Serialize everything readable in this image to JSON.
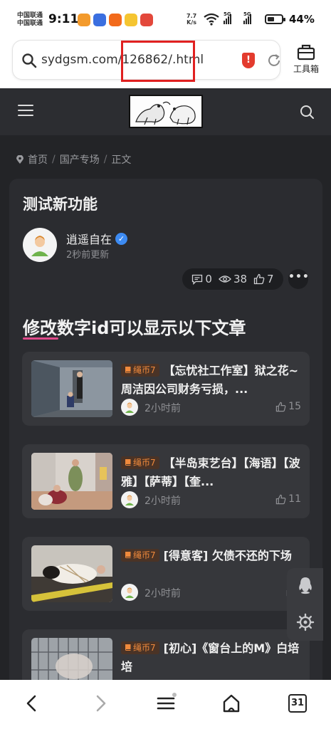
{
  "status_bar": {
    "carrier_1": "中国联通",
    "carrier_2": "中国联通",
    "time": "9:11",
    "net_speed_value": "7.7",
    "net_speed_unit": "K/s",
    "signal_1": "5G",
    "signal_2": "5G",
    "battery": "44%"
  },
  "browser": {
    "url": "sydgsm.com/126862/.html",
    "toolbox_label": "工具箱"
  },
  "breadcrumb": [
    "首页",
    "国产专场",
    "正文"
  ],
  "post": {
    "title": "测试新功能",
    "author": "逍遥自在",
    "updated": "2秒前更新",
    "comments": "0",
    "views": "38",
    "likes": "7"
  },
  "section": {
    "heading": "修改数字id可以显示以下文章"
  },
  "articles": [
    {
      "tag": "绳币7",
      "title": "【忘忧社工作室】狱之花~周洁因公司财务亏损，...",
      "time": "2小时前",
      "likes": "15"
    },
    {
      "tag": "绳币7",
      "title": "【半岛束艺台】【海语】【波雅】【萨蒂】【奎...",
      "time": "2小时前",
      "likes": "11"
    },
    {
      "tag": "绳币7",
      "title": "[得意客] 欠债不还的下场",
      "time": "2小时前",
      "likes": ""
    },
    {
      "tag": "绳币7",
      "title": "[初心]《窗台上的M》白培培",
      "time": "",
      "likes": ""
    }
  ],
  "bottom_nav": {
    "tabs_count": "31"
  },
  "colors": {
    "page_bg": "#232427",
    "card_bg": "#2b2c30",
    "item_bg": "#36373b",
    "accent_pink": "#e04a8a",
    "tag_orange": "#f08a3c",
    "verified_blue": "#3d8bf2",
    "url_highlight": "#e02020"
  },
  "icons": {
    "url_search": "search-icon",
    "security": "shield-icon",
    "reload": "reload-icon",
    "toolbox": "toolbox-icon",
    "menu": "hamburger-menu-icon",
    "site_search": "search-icon",
    "breadcrumb": "location-pin-icon",
    "comments": "comment-icon",
    "views": "eye-icon",
    "likes": "thumbs-up-icon",
    "more": "more-dots-icon",
    "tag": "book-icon",
    "float_1": "qq-penguin-icon",
    "float_2": "settings-gear-icon",
    "nav_back": "back-arrow-icon",
    "nav_forward": "forward-arrow-icon",
    "nav_menu": "menu-icon",
    "nav_home": "home-icon"
  }
}
